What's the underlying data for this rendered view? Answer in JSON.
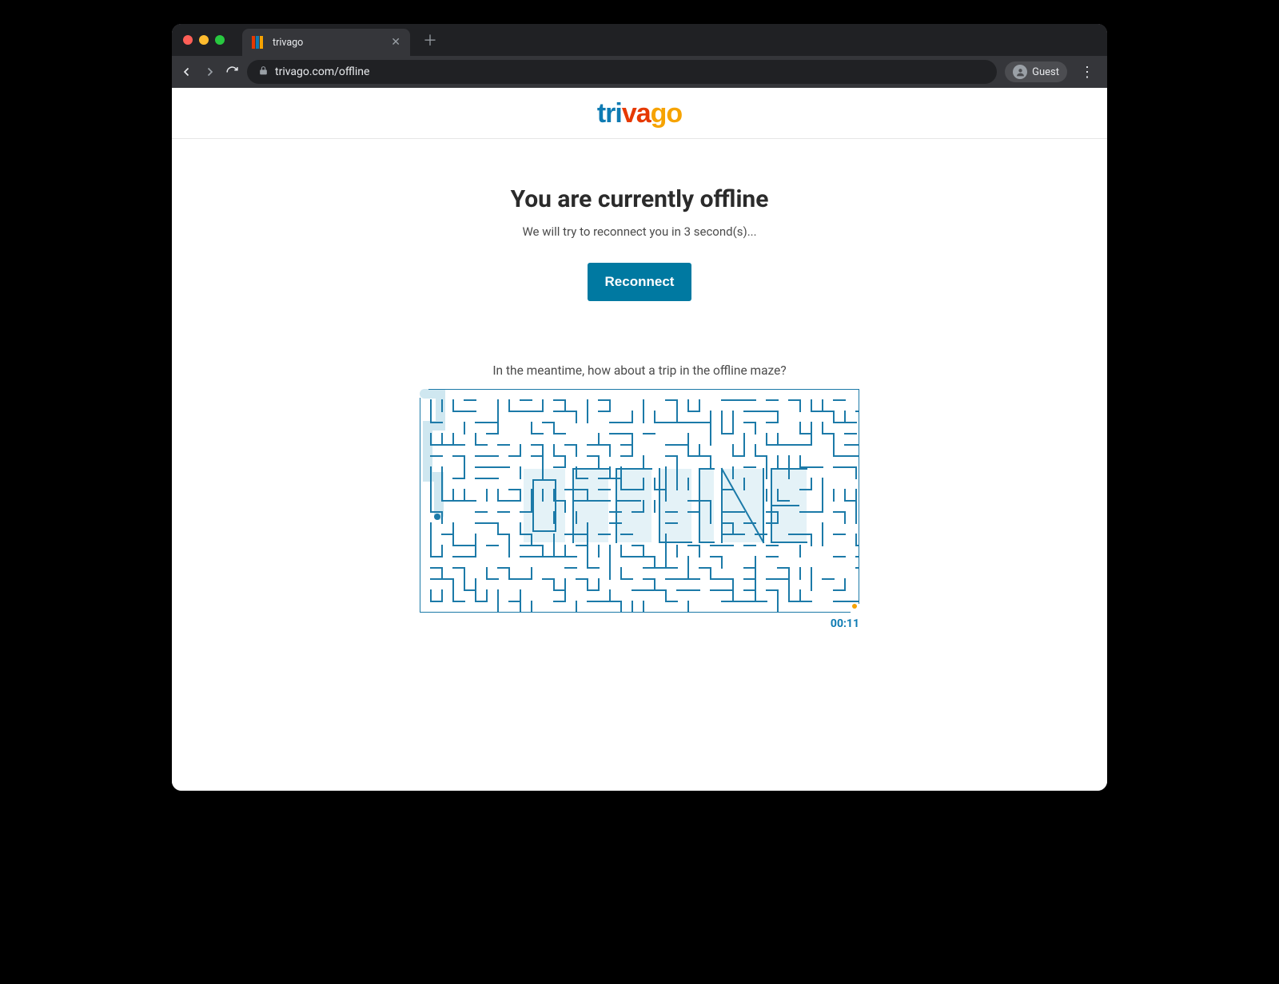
{
  "browser": {
    "tab_title": "trivago",
    "url": "trivago.com/offline",
    "profile_label": "Guest",
    "favicon_colors": [
      "#e63900",
      "#0e7bb3",
      "#f6a300"
    ]
  },
  "brand": {
    "part1": "tri",
    "part2": "va",
    "part3": "go"
  },
  "offline": {
    "heading": "You are currently offline",
    "subtext": "We will try to reconnect you in 3 second(s)...",
    "button_label": "Reconnect",
    "maze_prompt": "In the meantime, how about a trip in the offline maze?",
    "maze_word": "OFFLINE",
    "timer": "00:11"
  },
  "colors": {
    "accent": "#0079a1",
    "maze_stroke": "#1c7aa8",
    "maze_trail": "#cfe7f0",
    "maze_letters_bg": "#e4f2f7"
  }
}
